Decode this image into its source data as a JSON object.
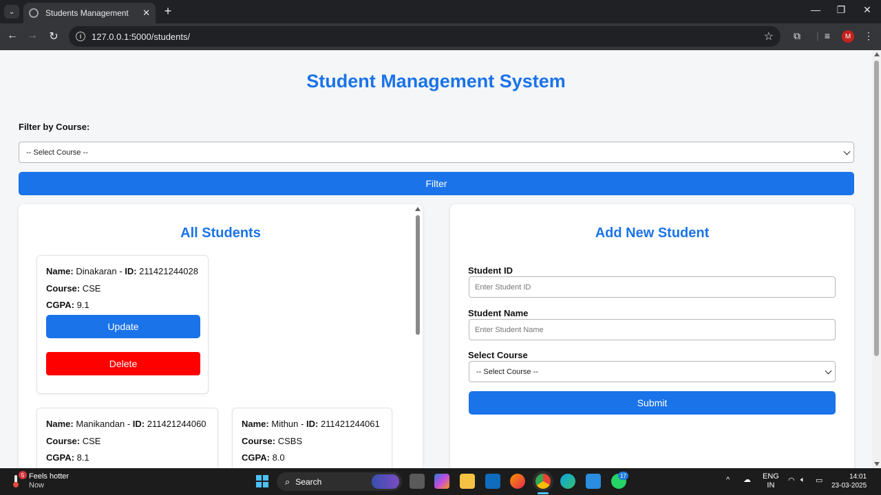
{
  "browser": {
    "tab_title": "Students Management",
    "url": "127.0.0.1:5000/students/",
    "profile_initial": "M"
  },
  "page": {
    "title": "Student Management System",
    "filter_label": "Filter by Course:",
    "filter_select_value": "-- Select Course --",
    "filter_button": "Filter"
  },
  "students_panel": {
    "title": "All Students",
    "labels": {
      "name": "Name:",
      "id": "ID:",
      "course": "Course:",
      "cgpa": "CGPA:"
    },
    "update_label": "Update",
    "delete_label": "Delete",
    "students": [
      {
        "name": "Dinakaran",
        "id": "211421244028",
        "course": "CSE",
        "cgpa": "9.1"
      },
      {
        "name": "Manikandan",
        "id": "211421244060",
        "course": "CSE",
        "cgpa": "8.1"
      },
      {
        "name": "Mithun",
        "id": "211421244061",
        "course": "CSBS",
        "cgpa": "8.0"
      }
    ]
  },
  "add_panel": {
    "title": "Add New Student",
    "student_id_label": "Student ID",
    "student_id_placeholder": "Enter Student ID",
    "student_name_label": "Student Name",
    "student_name_placeholder": "Enter Student Name",
    "course_label": "Select Course",
    "course_select_value": "-- Select Course --",
    "submit_label": "Submit"
  },
  "taskbar": {
    "weather_badge": "5",
    "weather_title": "Feels hotter",
    "weather_sub": "Now",
    "search_label": "Search",
    "whatsapp_badge": "17",
    "lang_top": "ENG",
    "lang_bottom": "IN",
    "time": "14:01",
    "date": "23-03-2025"
  },
  "colors": {
    "accent": "#1a73e8",
    "danger": "#ff0000"
  }
}
